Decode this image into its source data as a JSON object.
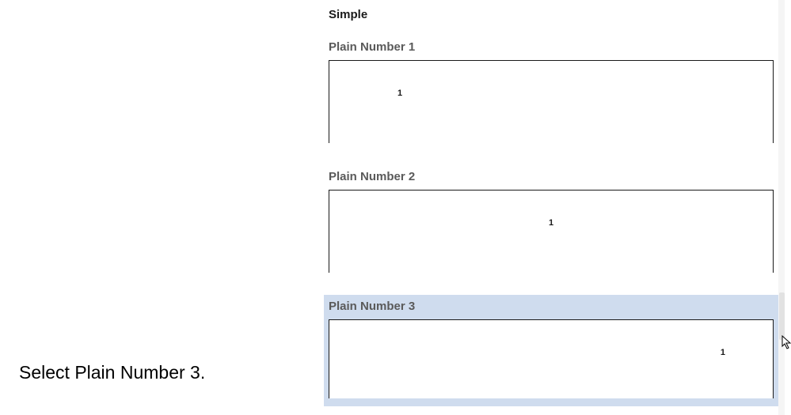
{
  "instruction": "Select Plain Number 3.",
  "gallery": {
    "category": "Simple",
    "items": [
      {
        "title": "Plain Number 1",
        "number": "1",
        "align": "left",
        "selected": false
      },
      {
        "title": "Plain Number 2",
        "number": "1",
        "align": "center",
        "selected": false
      },
      {
        "title": "Plain Number 3",
        "number": "1",
        "align": "right",
        "selected": true
      }
    ]
  }
}
